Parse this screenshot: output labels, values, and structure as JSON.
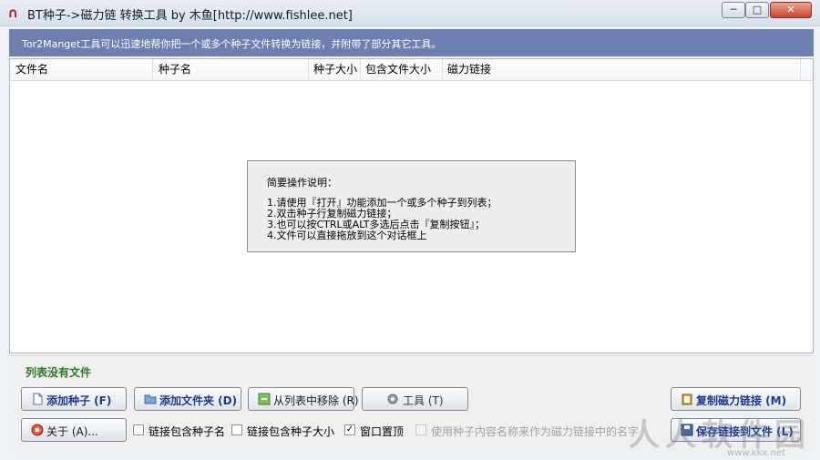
{
  "window": {
    "title": "BT种子->磁力链 转换工具 by 木鱼[http://www.fishlee.net]",
    "minimize": "─",
    "maximize": "□",
    "close": "✕"
  },
  "banner": {
    "text": "Tor2Manget工具可以迅速地帮你把一个或多个种子文件转换为链接，并附带了部分其它工具。"
  },
  "table": {
    "columns": [
      "文件名",
      "种子名",
      "种子大小",
      "包含文件大小",
      "磁力链接"
    ],
    "rows": []
  },
  "help": {
    "title": "简要操作说明：",
    "lines": [
      "1.请使用『打开』功能添加一个或多个种子到列表；",
      "2.双击种子行复制磁力链接；",
      "3.也可以按CTRL或ALT多选后点击『复制按钮』；",
      "4.文件可以直接拖放到这个对话框上"
    ]
  },
  "status": {
    "text": "列表没有文件"
  },
  "buttons": {
    "add_torrent": "添加种子 (F)",
    "add_folder": "添加文件夹 (D)",
    "remove": "从列表中移除 (R)",
    "tools": "工具 (T)",
    "copy_magnet": "复制磁力链接 (M)",
    "about": "关于 (A)...",
    "save_file": "保存链接到文件 (L)"
  },
  "options": {
    "include_name": {
      "label": "链接包含种子名",
      "checked": false
    },
    "include_size": {
      "label": "链接包含种子大小",
      "checked": false
    },
    "window_top": {
      "label": "窗口置顶",
      "checked": true
    },
    "use_content_name": {
      "label": "使用种子内容名称来作为磁力链接中的名字",
      "checked": false
    }
  },
  "watermark": {
    "text": "人人软件园",
    "url": "www.kkx.net"
  },
  "icons": {
    "app": "magnet-icon",
    "add": "document-icon",
    "folder": "folder-icon",
    "remove": "remove-icon",
    "tools": "gear-icon",
    "copy": "clipboard-icon",
    "about": "lifebuoy-icon",
    "save": "save-icon"
  },
  "colors": {
    "banner": "#6d7fae",
    "status": "#2d7a26",
    "button_text": "#1a3a8f"
  }
}
